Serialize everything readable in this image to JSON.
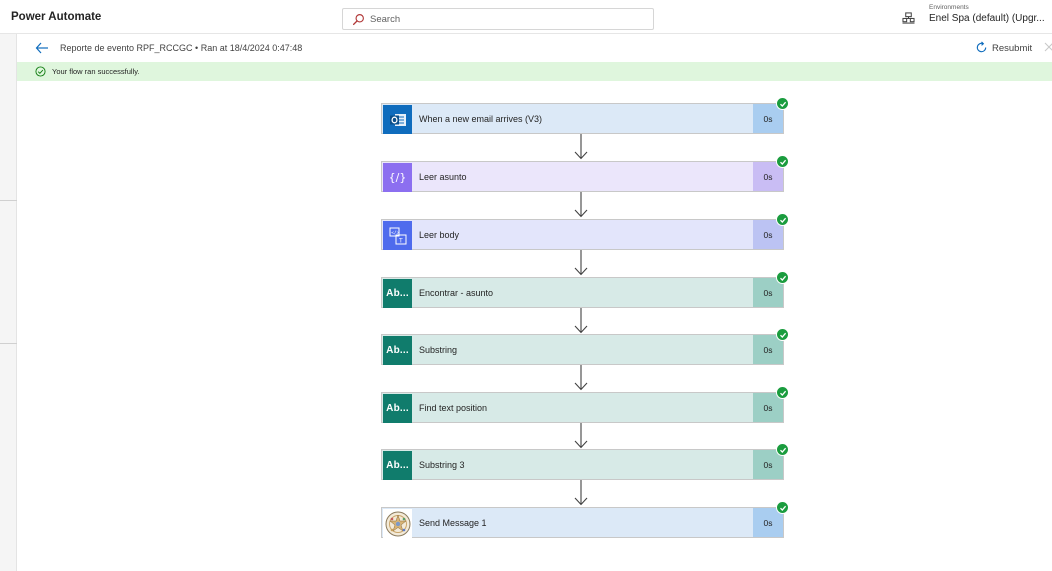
{
  "header": {
    "app_title": "Power Automate",
    "search_placeholder": "Search",
    "environment_label": "Environments",
    "environment_name": "Enel Spa (default) (Upgr..."
  },
  "command_bar": {
    "run_title": "Reporte de evento RPF_RCCGC • Ran at 18/4/2024 0:47:48",
    "resubmit_label": "Resubmit"
  },
  "banner": {
    "message": "Your flow ran successfully.",
    "color": "#dff6dd"
  },
  "flow": {
    "steps": [
      {
        "name": "When a new email arrives (V3)",
        "duration": "0s",
        "icon": "outlook-icon",
        "status": "succeeded"
      },
      {
        "name": "Leer asunto",
        "duration": "0s",
        "icon": "compose-icon",
        "status": "succeeded"
      },
      {
        "name": "Leer body",
        "duration": "0s",
        "icon": "html-to-text-icon",
        "status": "succeeded"
      },
      {
        "name": "Encontrar - asunto",
        "duration": "0s",
        "icon_text": "Ab...",
        "icon": "text-functions-icon",
        "status": "succeeded"
      },
      {
        "name": "Substring",
        "duration": "0s",
        "icon_text": "Ab...",
        "icon": "text-functions-icon",
        "status": "succeeded"
      },
      {
        "name": "Find text position",
        "duration": "0s",
        "icon_text": "Ab...",
        "icon": "text-functions-icon",
        "status": "succeeded"
      },
      {
        "name": "Substring 3",
        "duration": "0s",
        "icon_text": "Ab...",
        "icon": "text-functions-icon",
        "status": "succeeded"
      },
      {
        "name": "Send Message 1",
        "duration": "0s",
        "icon": "connector-logo-icon",
        "status": "succeeded"
      }
    ],
    "colors": {
      "success": "#1a9c3e",
      "outlook": "#0f6cbd",
      "compose": "#8c6ff0",
      "html": "#4f6bed",
      "text_functions": "#107c6c"
    }
  }
}
